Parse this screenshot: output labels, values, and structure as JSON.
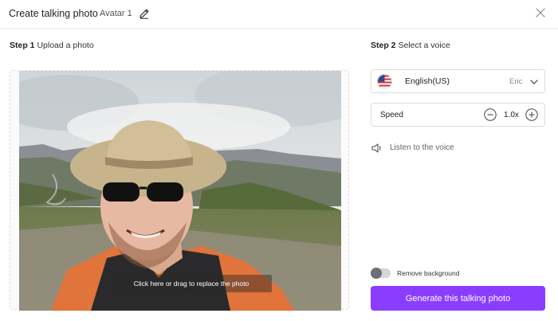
{
  "header": {
    "title": "Create talking photo -",
    "avatar_name": "Avatar 1",
    "edit_icon": "pencil-icon",
    "close_icon": "close-icon"
  },
  "step1": {
    "number": "Step 1",
    "label": "Upload a photo",
    "replace_hint": "Click here or drag to replace the photo"
  },
  "step2": {
    "number": "Step 2",
    "label": "Select a voice",
    "voice": {
      "flag": "us-flag-icon",
      "language": "English(US)",
      "name": "Eric"
    },
    "speed": {
      "label": "Speed",
      "value": "1.0x"
    },
    "listen_label": "Listen to the voice",
    "remove_background_label": "Remove background",
    "remove_background_on": false,
    "generate_label": "Generate this talking photo"
  },
  "colors": {
    "accent": "#8b3dff",
    "border": "#dcdcdc"
  }
}
